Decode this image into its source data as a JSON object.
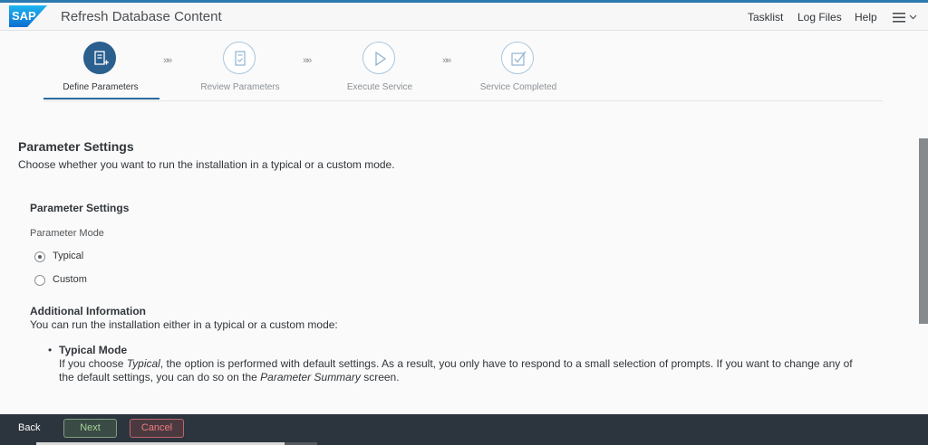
{
  "shell": {
    "app_title": "Refresh Database Content",
    "links": {
      "tasklist": "Tasklist",
      "log_files": "Log Files",
      "help": "Help"
    },
    "logo_text": "SAP"
  },
  "wizard": {
    "steps": [
      {
        "label": "Define Parameters",
        "state": "active",
        "icon": "edit-document-icon"
      },
      {
        "label": "Review Parameters",
        "state": "inactive",
        "icon": "checklist-icon"
      },
      {
        "label": "Execute Service",
        "state": "inactive",
        "icon": "play-icon"
      },
      {
        "label": "Service Completed",
        "state": "inactive",
        "icon": "checkbox-icon"
      }
    ],
    "separator": "»»"
  },
  "content": {
    "heading": "Parameter Settings",
    "description": "Choose whether you want to run the installation in a typical or a custom mode.",
    "section_heading": "Parameter Settings",
    "field_label": "Parameter Mode",
    "options": [
      {
        "label": "Typical",
        "checked": true
      },
      {
        "label": "Custom",
        "checked": false
      }
    ],
    "info": {
      "heading": "Additional Information",
      "text": "You can run the installation either in a typical or a custom mode:",
      "bullet": "•",
      "bullet_title": "Typical Mode",
      "bullet_text_1": "If you choose ",
      "bullet_text_em1": "Typical",
      "bullet_text_2": ", the option is performed with default settings. As a result, you only have to respond to a small selection of prompts. If you want to change any of the default settings, you can do so on the ",
      "bullet_text_em2": "Parameter Summary",
      "bullet_text_3": " screen."
    }
  },
  "footer": {
    "back": "Back",
    "next": "Next",
    "cancel": "Cancel"
  },
  "colors": {
    "accent": "#2a5f8e",
    "footer_bg": "#2c343e",
    "next": "#a6d39a",
    "cancel": "#ef7d7d"
  }
}
